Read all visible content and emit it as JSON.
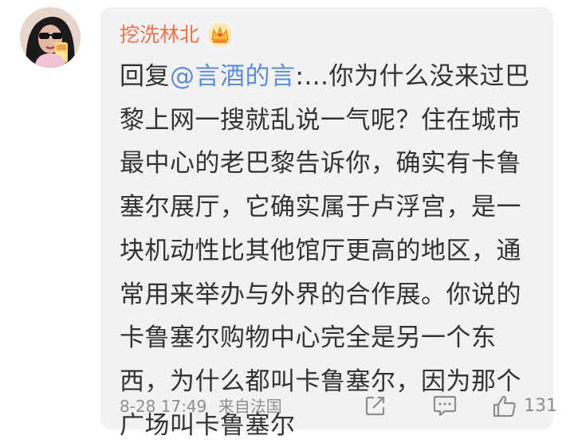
{
  "comment": {
    "username": "挖洗林北",
    "reply_prefix": "回复",
    "mention": "@言酒的言",
    "lines": [
      ":...你为什么没来过巴",
      "黎上网一搜就乱说一气呢？住在城市",
      "最中心的老巴黎告诉你，确实有卡鲁",
      "塞尔展厅，它确实属于卢浮宫，是一",
      "块机动性比其他馆厅更高的地区，通",
      "常用来举办与外界的合作展。你说的",
      "卡鲁塞尔购物中心完全是另一个东",
      "西，为什么都叫卡鲁塞尔，因为那个",
      "广场叫卡鲁塞尔"
    ],
    "timestamp": "8-28 17:49",
    "source": "来自法国",
    "like_count": "131"
  },
  "icons": {
    "vip": "crown-icon",
    "share": "share-icon",
    "reply": "comment-icon",
    "like": "thumbs-up-icon"
  },
  "colors": {
    "username": "#eb7350",
    "mention": "#5b8ed4",
    "text": "#333333",
    "meta": "#8e8e8e",
    "card_bg": "#f2f2f2"
  }
}
